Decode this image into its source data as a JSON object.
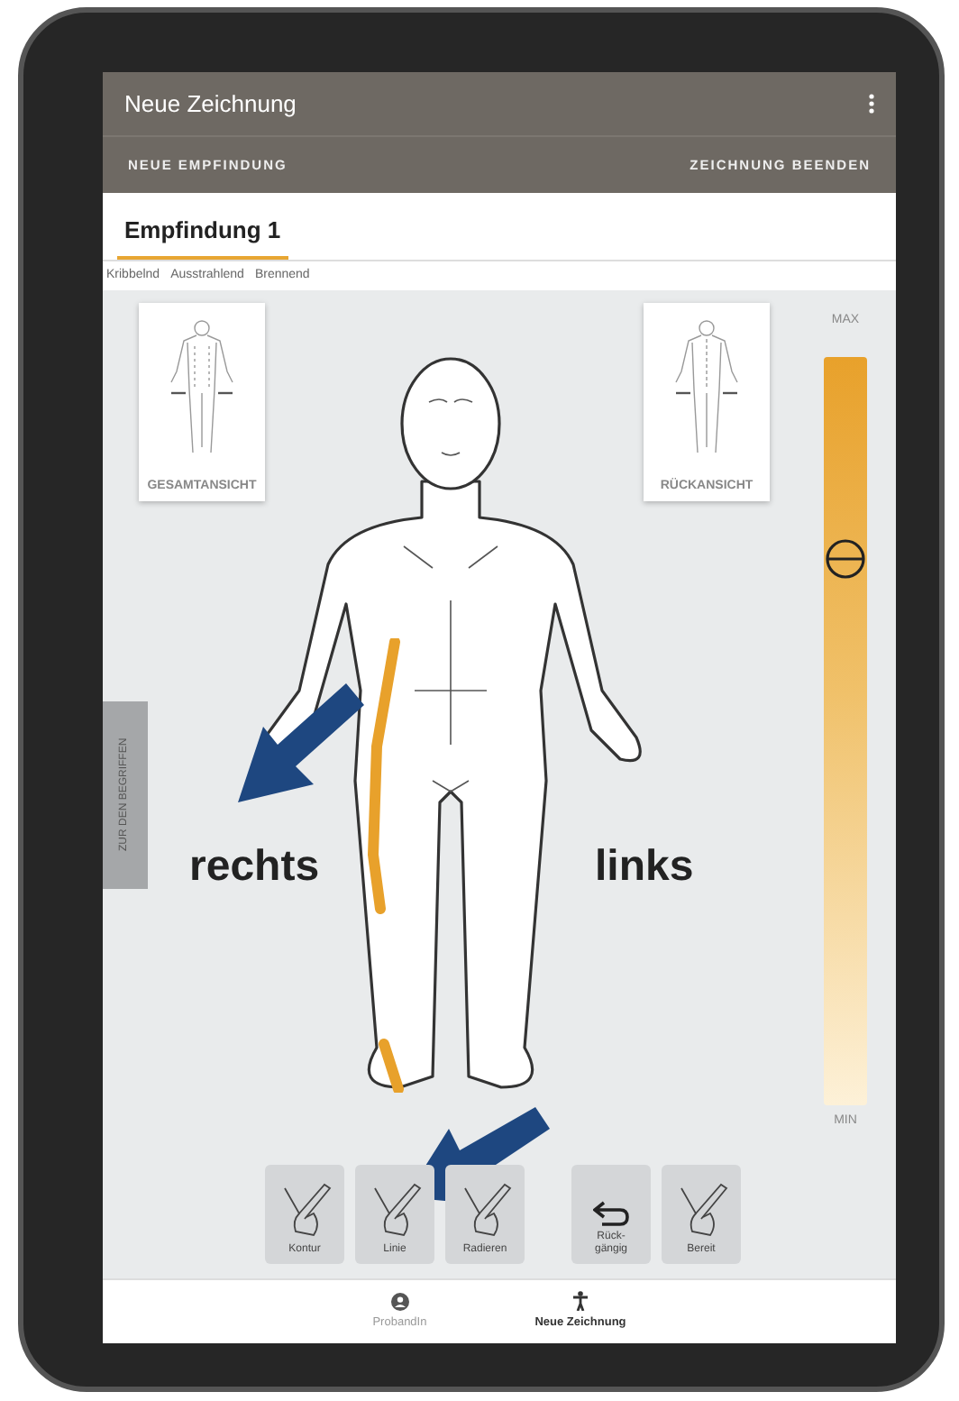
{
  "app_bar": {
    "title": "Neue Zeichnung"
  },
  "actions": [
    "NEUE EMPFINDUNG",
    "ZEICHNUNG BEENDEN"
  ],
  "tabs": [
    {
      "label": "Empfindung 1",
      "selected": true
    }
  ],
  "sensations": [
    "Kribbelnd",
    "Ausstrahlend",
    "Brennend"
  ],
  "views": [
    {
      "label": "GESAMTANSICHT",
      "kind": "front"
    },
    {
      "label": "RÜCKANSICHT",
      "kind": "back"
    }
  ],
  "side_tab": "ZUR DEN BEGRIFFEN",
  "body_labels": [
    "rechts",
    "links"
  ],
  "intensity": {
    "max_label": "MAX",
    "min_label": "MIN",
    "level": 0.73
  },
  "tools": [
    {
      "label": "Kontur",
      "kind": "pen"
    },
    {
      "label": "Linie",
      "kind": "pen"
    },
    {
      "label": "Radieren",
      "kind": "pen"
    },
    {
      "label": "Rück-\ngängig",
      "kind": "undo"
    },
    {
      "label": "Bereit",
      "kind": "pen"
    }
  ],
  "bottom_nav": [
    {
      "label": "ProbandIn",
      "kind": "person",
      "selected": false
    },
    {
      "label": "Neue Zeichnung",
      "kind": "figure",
      "selected": true
    }
  ]
}
